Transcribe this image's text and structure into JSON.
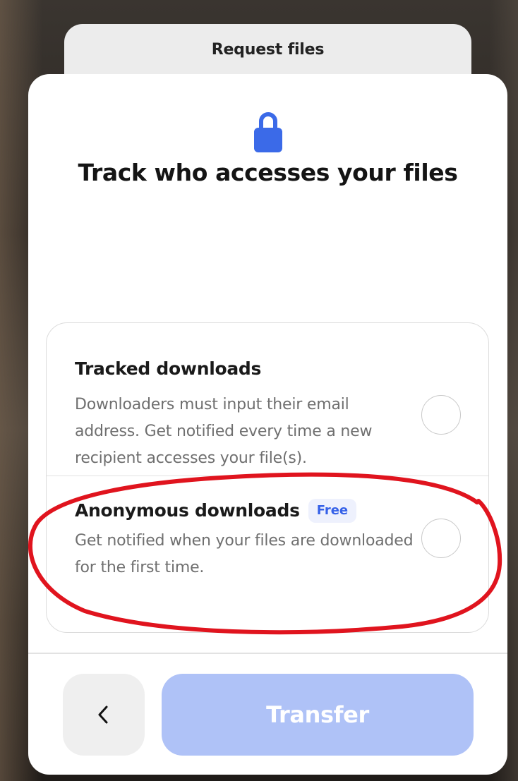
{
  "tab_behind": {
    "label": "Request files"
  },
  "panel": {
    "icon": "lock-icon",
    "title": "Track who accesses your files"
  },
  "options": [
    {
      "title": "Tracked downloads",
      "description": "Downloaders must input their email address. Get notified every time a new recipient accesses your file(s).",
      "selected": false
    },
    {
      "title": "Anonymous downloads",
      "badge": "Free",
      "description": "Get notified when your files are downloaded for the first time.",
      "selected": false
    }
  ],
  "footer": {
    "back_icon": "chevron-left-icon",
    "transfer_label": "Transfer"
  },
  "colors": {
    "accent": "#3561e8",
    "lock_icon": "#3b6ae8",
    "transfer_disabled": "#afc2f7",
    "annotation_red": "#e0141e"
  }
}
